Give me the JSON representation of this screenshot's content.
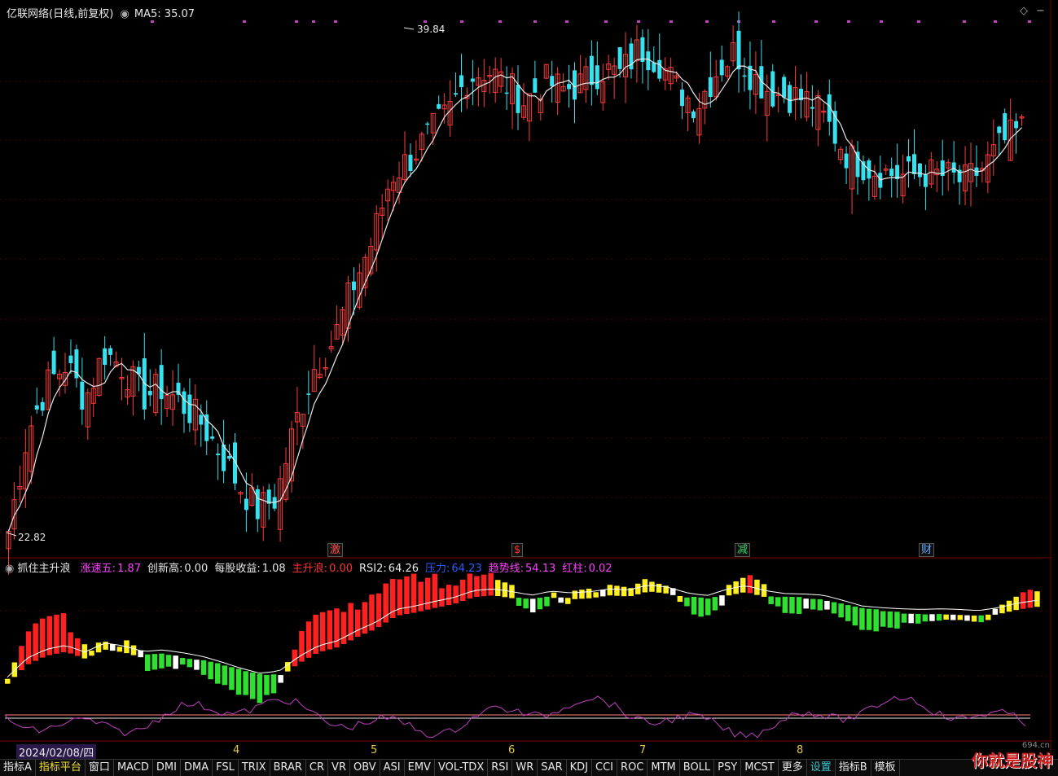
{
  "header": {
    "title": "亿联网络(日线,前复权)",
    "ma_label": "MA5: 35.07"
  },
  "price_labels": {
    "high": "39.84",
    "low": "22.82"
  },
  "markers": [
    {
      "text": "激",
      "color": "#ff5050"
    },
    {
      "text": "$",
      "color": "#ff3030"
    },
    {
      "text": "减",
      "color": "#36d06a"
    },
    {
      "text": "财",
      "color": "#66aaff"
    }
  ],
  "indicator": {
    "name": "抓住主升浪",
    "items": [
      {
        "label": "涨速五:",
        "value": "1.87",
        "color": "#ff40ff"
      },
      {
        "label": "创新高:",
        "value": "0.00",
        "color": "#e8e8e8"
      },
      {
        "label": "每股收益:",
        "value": "1.08",
        "color": "#e8e8e8"
      },
      {
        "label": "主升浪:",
        "value": "0.00",
        "color": "#ff3030"
      },
      {
        "label": "RSI2:",
        "value": "64.26",
        "color": "#e8e8e8"
      },
      {
        "label": "压力:",
        "value": "64.23",
        "color": "#2a5cff"
      },
      {
        "label": "趋势线:",
        "value": "54.13",
        "color": "#ff40ff"
      },
      {
        "label": "红柱:",
        "value": "0.02",
        "color": "#ff40ff"
      }
    ]
  },
  "date_axis": {
    "selected_date": "2024/02/08/四",
    "month_labels": [
      "4",
      "5",
      "6",
      "7",
      "8"
    ]
  },
  "tabs": [
    {
      "label": "指标A",
      "style": "normal"
    },
    {
      "label": "指标平台",
      "style": "hl"
    },
    {
      "label": "窗口",
      "style": "normal"
    },
    {
      "label": "MACD",
      "style": "normal"
    },
    {
      "label": "DMI",
      "style": "normal"
    },
    {
      "label": "DMA",
      "style": "normal"
    },
    {
      "label": "FSL",
      "style": "normal"
    },
    {
      "label": "TRIX",
      "style": "normal"
    },
    {
      "label": "BRAR",
      "style": "normal"
    },
    {
      "label": "CR",
      "style": "normal"
    },
    {
      "label": "VR",
      "style": "normal"
    },
    {
      "label": "OBV",
      "style": "normal"
    },
    {
      "label": "ASI",
      "style": "normal"
    },
    {
      "label": "EMV",
      "style": "normal"
    },
    {
      "label": "VOL-TDX",
      "style": "normal"
    },
    {
      "label": "RSI",
      "style": "normal"
    },
    {
      "label": "WR",
      "style": "normal"
    },
    {
      "label": "SAR",
      "style": "normal"
    },
    {
      "label": "KDJ",
      "style": "normal"
    },
    {
      "label": "CCI",
      "style": "normal"
    },
    {
      "label": "ROC",
      "style": "normal"
    },
    {
      "label": "MTM",
      "style": "normal"
    },
    {
      "label": "BOLL",
      "style": "normal"
    },
    {
      "label": "PSY",
      "style": "normal"
    },
    {
      "label": "MCST",
      "style": "normal"
    },
    {
      "label": "更多",
      "style": "normal"
    },
    {
      "label": "设置",
      "style": "teal"
    },
    {
      "label": "指标B",
      "style": "normal"
    },
    {
      "label": "模板",
      "style": "normal"
    }
  ],
  "watermark": "你就是股神",
  "watermark_small": "694.cn",
  "colors": {
    "up": "#ff3a3a",
    "down": "#36e1f0",
    "ma": "#e8e8e8",
    "purple": "#c040c0",
    "bar_red": "#ff2020",
    "bar_yellow": "#ffee20",
    "bar_green": "#30e030",
    "bar_white": "#ffffff"
  },
  "chart_data": {
    "type": "candlestick",
    "series": [
      {
        "name": "MA5",
        "last": 35.07
      }
    ],
    "ylim": [
      22.82,
      39.84
    ],
    "high_value": 39.84,
    "low_value": 22.82,
    "close_path": [
      22.9,
      26.2,
      27.8,
      28.5,
      27.3,
      28.9,
      28.4,
      27.4,
      27.7,
      27.2,
      26.6,
      25.6,
      24.5,
      23.6,
      24.0,
      26.5,
      28.4,
      29.3,
      31.1,
      32.6,
      34.8,
      35.4,
      36.2,
      36.9,
      38.1,
      38.4,
      37.9,
      37.3,
      38.0,
      37.7,
      37.9,
      38.4,
      38.2,
      39.1,
      38.7,
      37.7,
      37.2,
      38.3,
      39.0,
      38.1,
      37.6,
      37.5,
      37.3,
      36.4,
      35.4,
      35.1,
      34.9,
      34.8,
      34.9,
      34.8,
      34.6,
      35.1,
      35.9,
      36.4
    ],
    "indicator_bars": {
      "colors_sequence": "red,yellow,green,white",
      "trend_line": "white"
    }
  }
}
